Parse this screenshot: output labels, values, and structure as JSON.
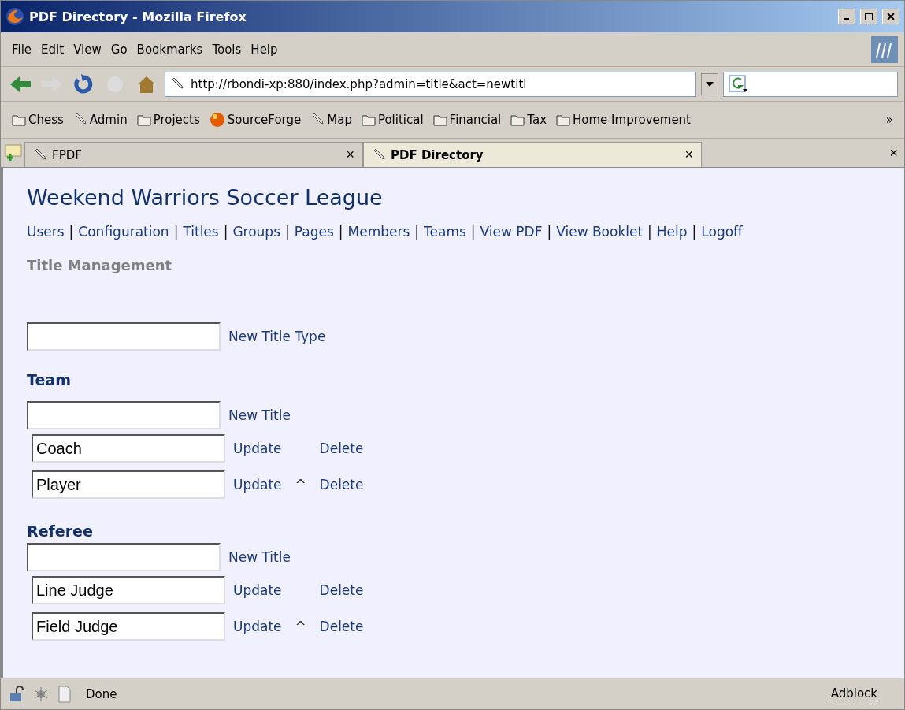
{
  "window": {
    "title": "PDF Directory - Mozilla Firefox"
  },
  "menu": [
    "File",
    "Edit",
    "View",
    "Go",
    "Bookmarks",
    "Tools",
    "Help"
  ],
  "address": {
    "value": "http://rbondi-xp:880/index.php?admin=title&act=newtitl"
  },
  "bookmarks": [
    {
      "label": "Chess",
      "kind": "folder"
    },
    {
      "label": "Admin",
      "kind": "link"
    },
    {
      "label": "Projects",
      "kind": "folder"
    },
    {
      "label": "SourceForge",
      "kind": "site"
    },
    {
      "label": "Map",
      "kind": "link"
    },
    {
      "label": "Political",
      "kind": "folder"
    },
    {
      "label": "Financial",
      "kind": "folder"
    },
    {
      "label": "Tax",
      "kind": "folder"
    },
    {
      "label": "Home Improvement",
      "kind": "folder"
    }
  ],
  "more": "»",
  "tabs": [
    {
      "label": "FPDF",
      "selected": false,
      "close": "×"
    },
    {
      "label": "PDF Directory",
      "selected": true,
      "close": "×"
    }
  ],
  "tabs_close": "×",
  "page": {
    "heading": "Weekend Warriors Soccer League",
    "nav_separator": "|",
    "nav": [
      "Users",
      "Configuration",
      "Titles",
      "Groups",
      "Pages",
      "Members",
      "Teams",
      "View PDF",
      "View Booklet",
      "Help",
      "Logoff"
    ],
    "section": "Title Management",
    "new_type_label": "New Title Type",
    "groups": [
      {
        "name": "Team",
        "new_label": "New Title",
        "titles": [
          {
            "value": "Coach",
            "update": "Update",
            "delete": "Delete"
          },
          {
            "value": "Player",
            "update": "Update",
            "move_up": "^",
            "delete": "Delete"
          }
        ]
      },
      {
        "name": "Referee",
        "new_label": "New Title",
        "titles": [
          {
            "value": "Line Judge",
            "update": "Update",
            "delete": "Delete"
          },
          {
            "value": "Field Judge",
            "update": "Update",
            "move_up": "^",
            "delete": "Delete"
          }
        ]
      }
    ]
  },
  "status_bar": {
    "text": "Done",
    "adblock": "Adblock"
  }
}
